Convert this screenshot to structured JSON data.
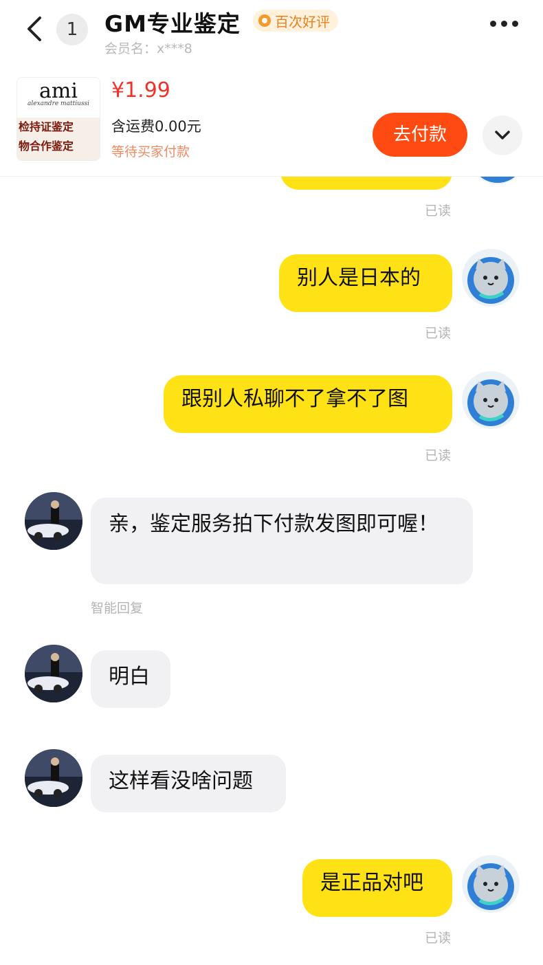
{
  "header": {
    "unread_count": "1",
    "title": "GM专业鉴定",
    "rating_badge": "百次好评",
    "member_label": "会员名：x***8"
  },
  "order": {
    "product_logo": "ami",
    "product_logo_sub": "alexandre mattiussi",
    "product_banner_line1": "检持证鉴定",
    "product_banner_line2": "物合作鉴定",
    "price": "¥1.99",
    "shipping": "含运费0.00元",
    "status": "等待买家付款",
    "pay_button": "去付款"
  },
  "messages": [
    {
      "side": "me",
      "text": "",
      "read": "已读"
    },
    {
      "side": "me",
      "text": "别人是日本的",
      "read": "已读"
    },
    {
      "side": "me",
      "text": "跟别人私聊不了拿不了图",
      "read": "已读"
    },
    {
      "side": "them",
      "text": "亲，鉴定服务拍下付款发图即可喔！",
      "note": "智能回复"
    },
    {
      "side": "them",
      "text": "明白"
    },
    {
      "side": "them",
      "text": "这样看没啥问题"
    },
    {
      "side": "me",
      "text": "是正品对吧",
      "read": "已读"
    }
  ],
  "colors": {
    "my_bubble": "#ffe216",
    "their_bubble": "#f1f1f4",
    "price": "#f2322a",
    "pay_button": "#ff4b12",
    "status": "#f08a62"
  }
}
